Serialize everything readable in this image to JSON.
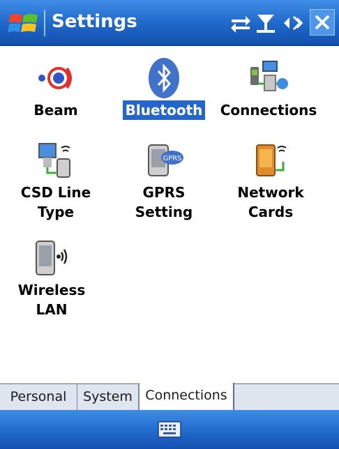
{
  "window": {
    "title": "Settings"
  },
  "status_icons": [
    "sync-icon",
    "signal-icon",
    "speaker-icon",
    "close-icon"
  ],
  "items": [
    {
      "label": "Beam",
      "icon": "beam-icon",
      "selected": false
    },
    {
      "label": "Bluetooth",
      "icon": "bluetooth-icon",
      "selected": true
    },
    {
      "label": "Connections",
      "icon": "connections-icon",
      "selected": false
    },
    {
      "label1": "CSD Line",
      "label2": "Type",
      "icon": "csd-line-type-icon"
    },
    {
      "label1": "GPRS",
      "label2": "Setting",
      "icon": "gprs-setting-icon"
    },
    {
      "label1": "Network",
      "label2": "Cards",
      "icon": "network-cards-icon"
    },
    {
      "label1": "Wireless",
      "label2": "LAN",
      "icon": "wireless-lan-icon"
    }
  ],
  "tabs": [
    {
      "label": "Personal",
      "active": false
    },
    {
      "label": "System",
      "active": false
    },
    {
      "label": "Connections",
      "active": true
    }
  ],
  "menubar": {
    "icon": "keyboard-icon"
  },
  "colors": {
    "titlebar": "#1f66c9",
    "selection": "#2566c9",
    "tab_bg": "#dfe6f0"
  }
}
